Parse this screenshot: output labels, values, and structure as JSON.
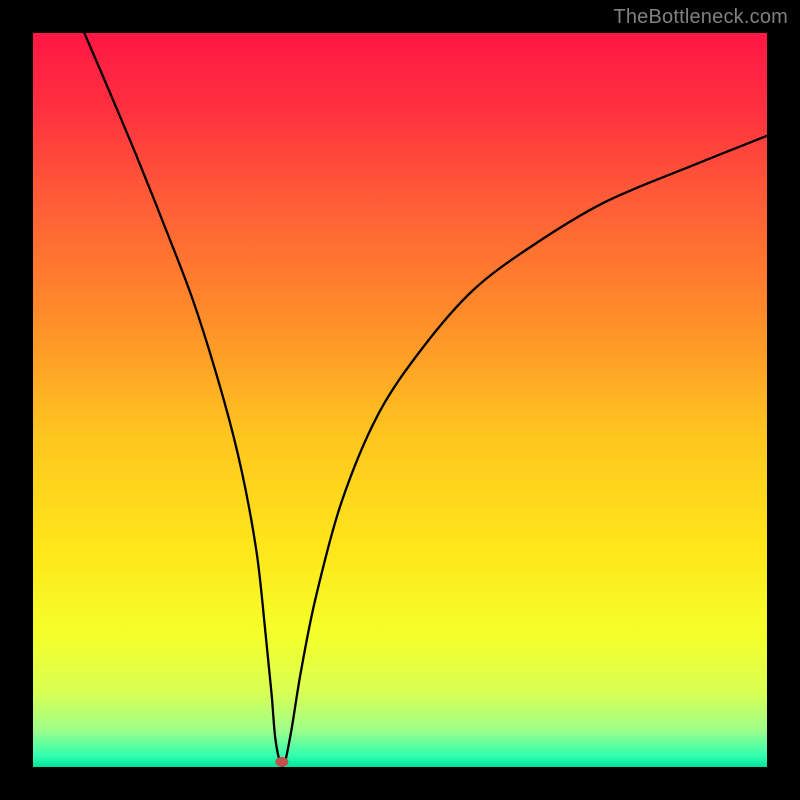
{
  "attribution": "TheBottleneck.com",
  "chart_data": {
    "type": "line",
    "title": "",
    "xlabel": "",
    "ylabel": "",
    "xlim": [
      0,
      100
    ],
    "ylim": [
      0,
      100
    ],
    "legend": false,
    "gradient_stops": [
      {
        "offset": 0.0,
        "color": "#ff1744"
      },
      {
        "offset": 0.1,
        "color": "#ff2f3f"
      },
      {
        "offset": 0.22,
        "color": "#ff5a37"
      },
      {
        "offset": 0.38,
        "color": "#ff8a2a"
      },
      {
        "offset": 0.55,
        "color": "#ffc61f"
      },
      {
        "offset": 0.7,
        "color": "#ffe61a"
      },
      {
        "offset": 0.82,
        "color": "#f4ff2a"
      },
      {
        "offset": 0.9,
        "color": "#d8ff55"
      },
      {
        "offset": 0.95,
        "color": "#9dff8a"
      },
      {
        "offset": 0.985,
        "color": "#30ffb0"
      },
      {
        "offset": 1.0,
        "color": "#00e39a"
      }
    ],
    "curve": {
      "x": [
        7,
        10,
        14,
        18,
        22,
        26,
        28.5,
        30.5,
        31.7,
        32.5,
        33.0,
        33.7,
        34.3,
        35.2,
        36.5,
        38.5,
        42,
        47,
        53,
        60,
        68,
        78,
        90,
        100
      ],
      "y": [
        100,
        93,
        83.5,
        73.5,
        63,
        50,
        40,
        29,
        18,
        10,
        4,
        0.6,
        0.6,
        5,
        13,
        23,
        36,
        48,
        57,
        65,
        71,
        77,
        82,
        86
      ]
    },
    "marker": {
      "x": 33.9,
      "y": 0.7,
      "color": "#c1524b"
    }
  }
}
